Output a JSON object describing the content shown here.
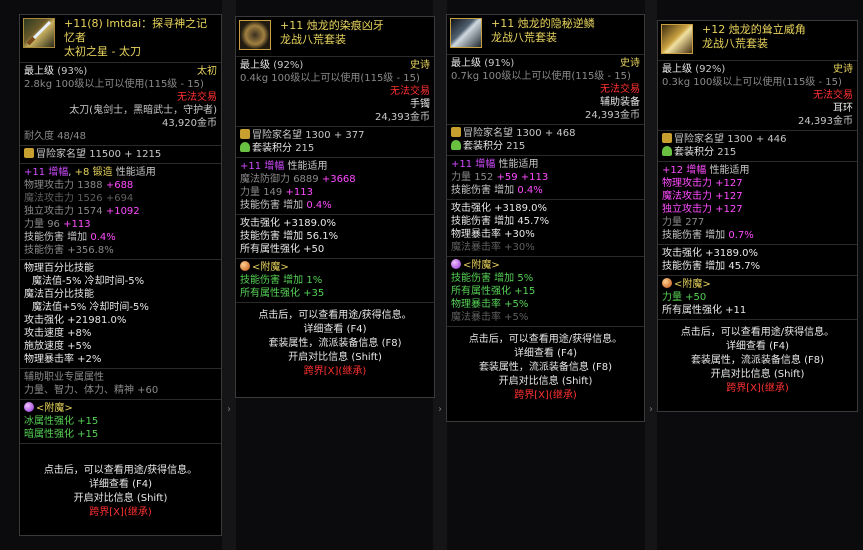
{
  "p1": {
    "title": "+11(8) lmtdai：探寻神之记忆者",
    "subtitle": "太初之星 - 太刀",
    "grade": "最上级",
    "grade_pct": "(93%)",
    "rarity": "太初",
    "weight": "2.8kg",
    "level_req": "100级以上可以使用(115级 - 15)",
    "trade": "无法交易",
    "classes": "太刀(鬼剑士，黑暗武士，守护者)",
    "price": "43,920金币",
    "durability": "耐久度 48/48",
    "renown_label": "冒险家名望",
    "renown_val": "11500",
    "renown_add": "+ 1215",
    "amp_a": "+11",
    "amp_b": "增幅",
    "amp_c": "+8",
    "amp_d": "锻造",
    "amp_e": "性能适用",
    "s1": "物理攻击力",
    "s1v": "1388",
    "s1a": "+688",
    "s2": "魔法攻击力",
    "s2v": "1526",
    "s2a": "+694",
    "s3": "独立攻击力",
    "s3v": "1574",
    "s3a": "+1092",
    "s4": "力量",
    "s4v": "96",
    "s4a": "+113",
    "s5": "技能伤害 增加",
    "s5a": "0.4%",
    "s6": "技能伤害",
    "s6a": "+356.8%",
    "opt1": "物理百分比技能",
    "opt2": "魔法值-5% 冷却时间-5%",
    "opt3": "魔法百分比技能",
    "opt4": "魔法值+5% 冷却时间-5%",
    "opt5": "攻击强化 +21981.0%",
    "opt6": "攻击速度 +8%",
    "opt7": "施放速度 +5%",
    "opt8": "物理暴击率 +2%",
    "aux1": "辅助职业专属属性",
    "aux2": "力量、智力、体力、精神 +60",
    "ench": "<附魔>",
    "e1": "冰属性强化 +15",
    "e2": "暗属性强化 +15",
    "f1": "点击后，可以查看用途/获得信息。",
    "f2": "详细查看 (F4)",
    "f3": "开启对比信息 (Shift)",
    "f4": "跨界[X](继承)"
  },
  "p2": {
    "title": "+11 烛龙的染痕凶牙",
    "subtitle": "龙战八荒套装",
    "grade": "最上级",
    "grade_pct": "(92%)",
    "rarity": "史诗",
    "weight": "0.4kg",
    "level_req": "100级以上可以使用(115级 - 15)",
    "trade": "无法交易",
    "slot": "手镯",
    "price": "24,393金币",
    "renown_label": "冒险家名望",
    "renown_val": "1300",
    "renown_add": "+ 377",
    "set_label": "套装积分",
    "set_val": "215",
    "amp_a": "+11",
    "amp_b": "增幅",
    "amp_e": "性能适用",
    "s1": "魔法防御力",
    "s1v": "6889",
    "s1a": "+3668",
    "s2": "力量",
    "s2v": "149",
    "s2a": "+113",
    "s3": "技能伤害 增加",
    "s3a": "0.4%",
    "o1": "攻击强化 +3189.0%",
    "o2": "技能伤害 增加 56.1%",
    "o3": "所有属性强化 +50",
    "ench": "<附魔>",
    "e1": "技能伤害 增加 1%",
    "e2": "所有属性强化 +35",
    "f1": "点击后，可以查看用途/获得信息。",
    "f2": "详细查看 (F4)",
    "f3": "套装属性，流派装备信息 (F8)",
    "f4": "开启对比信息 (Shift)",
    "f5": "跨界[X](继承)"
  },
  "p3": {
    "title": "+11 烛龙的隐秘逆鳞",
    "subtitle": "龙战八荒套装",
    "grade": "最上级",
    "grade_pct": "(91%)",
    "rarity": "史诗",
    "weight": "0.7kg",
    "level_req": "100级以上可以使用(115级 - 15)",
    "trade": "无法交易",
    "slot": "辅助装备",
    "price": "24,393金币",
    "renown_label": "冒险家名望",
    "renown_val": "1300",
    "renown_add": "+ 468",
    "set_label": "套装积分",
    "set_val": "215",
    "amp_a": "+11",
    "amp_b": "增幅",
    "amp_e": "性能适用",
    "s1": "力量",
    "s1v": "152",
    "s1b": "+59",
    "s1a": "+113",
    "s2": "技能伤害 增加",
    "s2a": "0.4%",
    "o1": "攻击强化 +3189.0%",
    "o2": "技能伤害 增加 45.7%",
    "o3": "物理暴击率 +30%",
    "o4": "魔法暴击率 +30%",
    "ench": "<附魔>",
    "e1": "技能伤害 增加 5%",
    "e2": "所有属性强化 +15",
    "e3": "物理暴击率 +5%",
    "e4": "魔法暴击率 +5%",
    "f1": "点击后，可以查看用途/获得信息。",
    "f2": "详细查看 (F4)",
    "f3": "套装属性，流派装备信息 (F8)",
    "f4": "开启对比信息 (Shift)",
    "f5": "跨界[X](继承)"
  },
  "p4": {
    "title": "+12 烛龙的耸立威角",
    "subtitle": "龙战八荒套装",
    "grade": "最上级",
    "grade_pct": "(92%)",
    "rarity": "史诗",
    "weight": "0.3kg",
    "level_req": "100级以上可以使用(115级 - 15)",
    "trade": "无法交易",
    "slot": "耳环",
    "price": "24,393金币",
    "renown_label": "冒险家名望",
    "renown_val": "1300",
    "renown_add": "+ 446",
    "set_label": "套装积分",
    "set_val": "215",
    "amp_a": "+12",
    "amp_b": "增幅",
    "amp_e": "性能适用",
    "m1": "物理攻击力 +127",
    "m2": "魔法攻击力 +127",
    "m3": "独立攻击力 +127",
    "s1": "力量",
    "s1v": "277",
    "s2": "技能伤害 增加",
    "s2a": "0.7%",
    "o1": "攻击强化 +3189.0%",
    "o2": "技能伤害 增加 45.7%",
    "ench": "<附魔>",
    "e1": "力量 +50",
    "e2": "所有属性强化 +11",
    "f1": "点击后，可以查看用途/获得信息。",
    "f2": "详细查看 (F4)",
    "f3": "套装属性，流派装备信息 (F8)",
    "f4": "开启对比信息 (Shift)",
    "f5": "跨界[X](继承)"
  },
  "colors": {
    "gold": "#e9d45d",
    "green": "#55d255",
    "purple": "#d04cff",
    "magenta": "#ff4cff",
    "red": "#ff3030"
  }
}
